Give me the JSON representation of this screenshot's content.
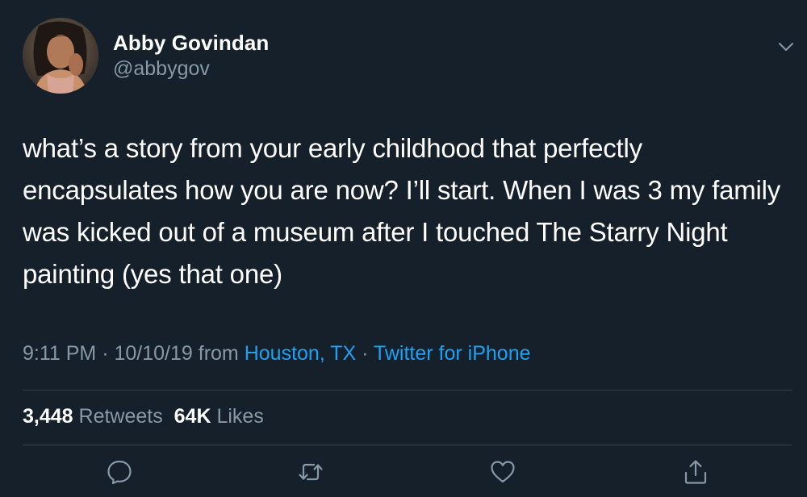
{
  "author": {
    "name": "Abby Govindan",
    "handle": "@abbygov"
  },
  "tweet": {
    "text": "what’s a story from your early childhood that perfectly encapsulates how you are now? I’ll start. When I was 3 my family was kicked out of a museum after I touched The Starry Night painting (yes that one)"
  },
  "meta": {
    "time": "9:11 PM",
    "sep1": " · ",
    "date": "10/10/19",
    "from": " from ",
    "location": "Houston, TX",
    "sep2": " · ",
    "source": "Twitter for iPhone"
  },
  "stats": {
    "retweets_count": "3,448",
    "retweets_label": "Retweets",
    "likes_count": "64K",
    "likes_label": "Likes"
  },
  "icons": {
    "menu": "chevron-down-icon",
    "reply": "reply-icon",
    "retweet": "retweet-icon",
    "like": "heart-icon",
    "share": "share-icon"
  },
  "colors": {
    "background": "#15202b",
    "text": "#ffffff",
    "muted": "#8899a6",
    "link": "#1da1f2",
    "divider": "#38444d"
  }
}
